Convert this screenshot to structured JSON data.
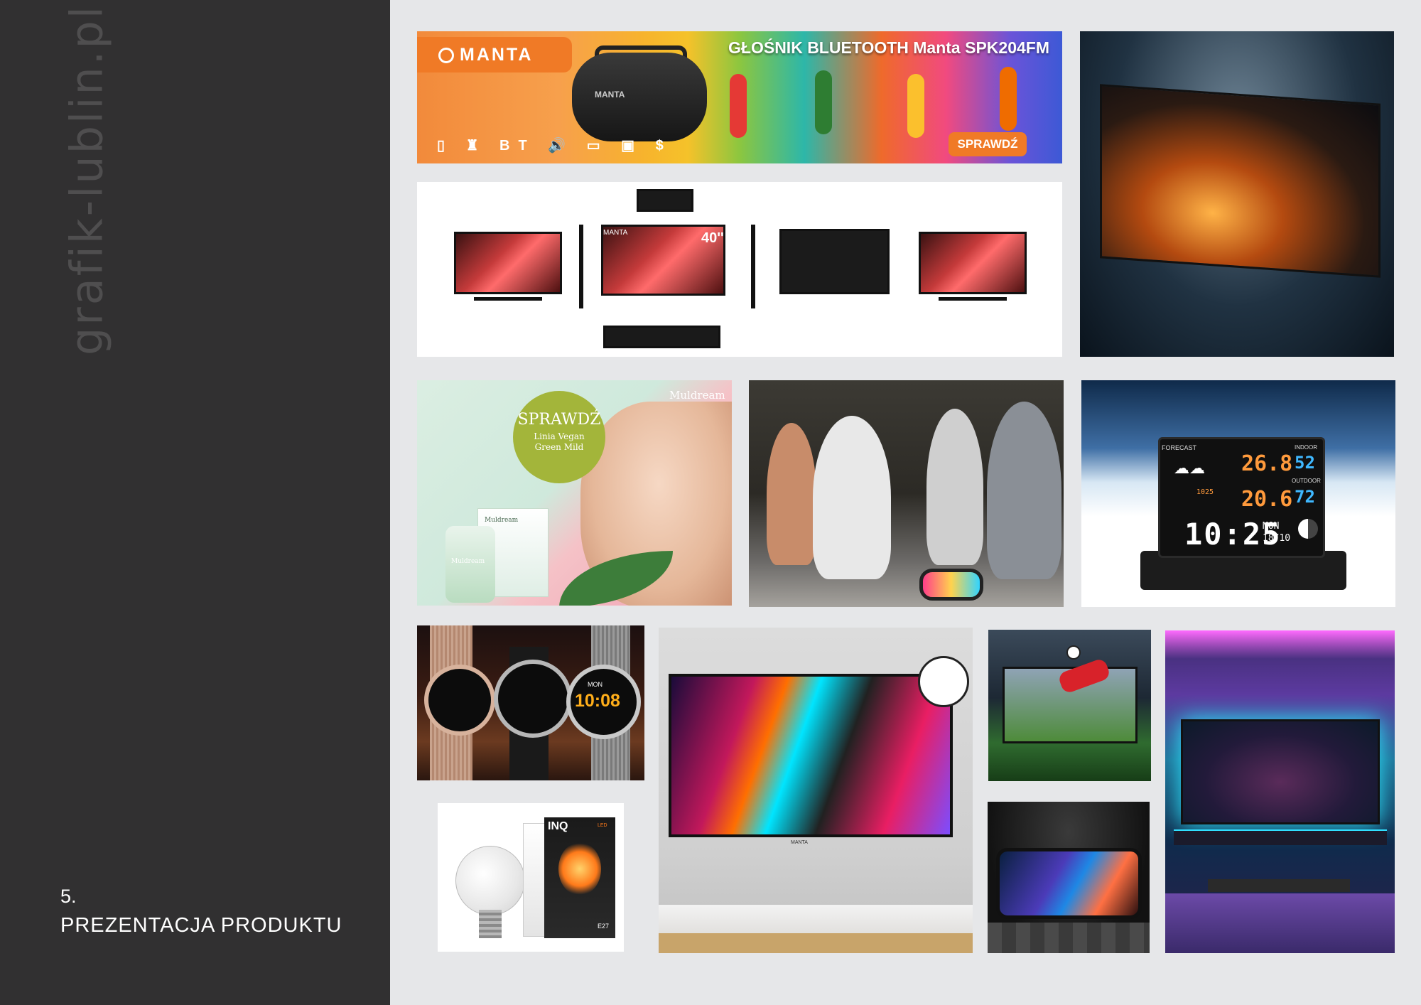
{
  "sidebar": {
    "brand": "grafik-lublin.pl",
    "section_number": "5.",
    "section_title": "PREZENTACJA PRODUKTU"
  },
  "banner": {
    "logo": "MANTA",
    "title": "GŁOŚNIK BLUETOOTH Manta SPK204FM",
    "speaker_brand": "MANTA",
    "features": "▯ ♜ BT 🔊 ▭ ▣ $",
    "cta": "SPRAWDŹ"
  },
  "tv_views": {
    "badge": "40''",
    "brand": "MANTA"
  },
  "cosmetics": {
    "brand": "Muldream",
    "badge_title": "SPRAWDŹ",
    "badge_line1": "Linia Vegan",
    "badge_line2": "Green Mild",
    "box_label": "Muldream",
    "bottle_label": "Muldream"
  },
  "weather": {
    "forecast_label": "FORECAST",
    "indoor_label": "INDOOR",
    "outdoor_label": "OUTDOOR",
    "temp_indoor": "26.8",
    "temp_outdoor": "20.6",
    "humidity_indoor": "52",
    "humidity_outdoor": "72",
    "pressure": "1025",
    "time": "10:25",
    "day": "MON",
    "date": "18/10"
  },
  "watches": {
    "time": "10:08",
    "day": "MON"
  },
  "bulb": {
    "box_brand": "INQ",
    "box_label": "LED",
    "socket": "E27"
  },
  "racing_tv": {
    "brand": "MANTA"
  },
  "colors": {
    "sidebar_bg": "#313031",
    "page_bg": "#e6e7e9",
    "accent_orange": "#f07a26"
  }
}
